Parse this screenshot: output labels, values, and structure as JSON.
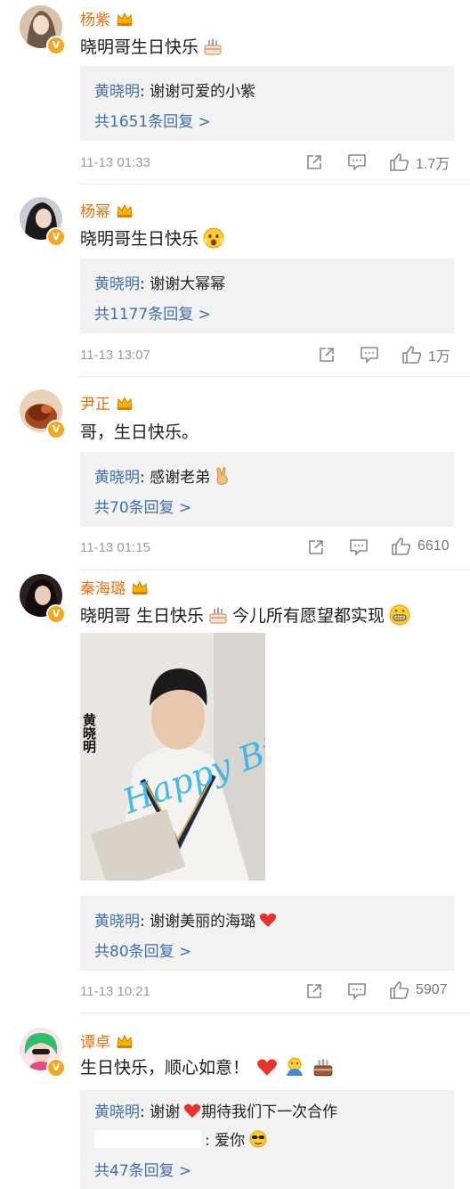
{
  "comments": [
    {
      "username": "杨紫",
      "text": "晓明哥生日快乐",
      "reply_name": "黄晓明",
      "reply_text": ": 谢谢可爱的小紫",
      "more_replies": "共1651条回复 >",
      "time": "11-13 01:33",
      "likes": "1.7万"
    },
    {
      "username": "杨幂",
      "text": "晓明哥生日快乐",
      "reply_name": "黄晓明",
      "reply_text": ": 谢谢大幂幂",
      "more_replies": "共1177条回复 >",
      "time": "11-13 13:07",
      "likes": "1万"
    },
    {
      "username": "尹正",
      "text": "哥，生日快乐。",
      "reply_name": "黄晓明",
      "reply_text": ": 感谢老弟",
      "more_replies": "共70条回复 >",
      "time": "11-13 01:15",
      "likes": "6610"
    },
    {
      "username": "秦海璐",
      "text_a": "晓明哥 生日快乐",
      "text_b": "今儿所有愿望都实现",
      "image_text": "黄晓明",
      "image_script": "Happy Birthday",
      "reply_name": "黄晓明",
      "reply_text": ": 谢谢美丽的海璐",
      "more_replies": "共80条回复 >",
      "time": "11-13 10:21",
      "likes": "5907"
    },
    {
      "username": "谭卓",
      "text": "生日快乐，顺心如意！",
      "reply_name": "黄晓明",
      "reply_text_a": ": 谢谢",
      "reply_text_b": "期待我们下一次合作",
      "reply2_text": ": 爱你",
      "more_replies": "共47条回复 >"
    }
  ],
  "colors": {
    "username": "#e8710a",
    "link": "#3d6fa8",
    "meta": "#9b9b9b",
    "reply_bg": "#f2f2f2"
  },
  "icons": [
    "crown-vip-icon",
    "verified-badge-icon",
    "share-icon",
    "comment-icon",
    "like-icon",
    "cake-emoji",
    "heart-emoji"
  ]
}
